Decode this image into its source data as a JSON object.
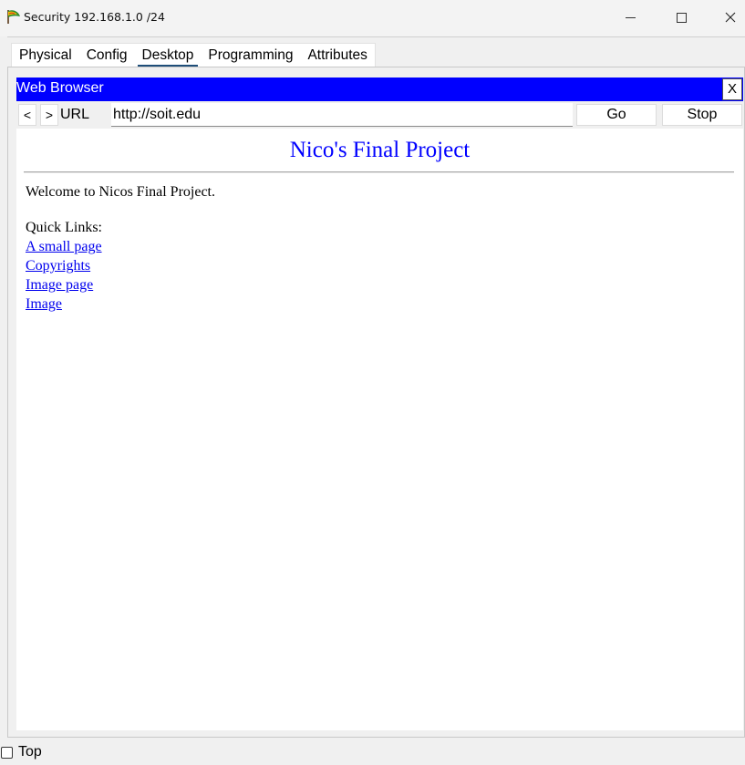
{
  "window": {
    "title": "Security 192.168.1.0 /24",
    "controls": {
      "minimize": "minimize",
      "maximize": "maximize",
      "close": "close"
    }
  },
  "tabs": [
    {
      "label": "Physical",
      "active": false
    },
    {
      "label": "Config",
      "active": false
    },
    {
      "label": "Desktop",
      "active": true
    },
    {
      "label": "Programming",
      "active": false
    },
    {
      "label": "Attributes",
      "active": false
    }
  ],
  "browser": {
    "title": "Web Browser",
    "close_label": "X",
    "back_label": "<",
    "forward_label": ">",
    "url_label": "URL",
    "url_value": "http://soit.edu",
    "go_label": "Go",
    "stop_label": "Stop"
  },
  "page": {
    "heading": "Nico's Final Project",
    "welcome": "Welcome to Nicos Final Project.",
    "quick_links_label": "Quick Links:",
    "links": [
      "A small page",
      "Copyrights",
      "Image page",
      "Image"
    ]
  },
  "footer": {
    "top_label": "Top",
    "top_checked": false
  },
  "colors": {
    "browser_header": "#0000ff",
    "heading": "#0000ff",
    "link": "#0000ee",
    "tab_underline": "#1f4e79"
  },
  "icons": {
    "app": "packet-tracer-leaf-icon",
    "minimize": "minimize-icon",
    "maximize": "maximize-icon",
    "close": "close-icon"
  }
}
